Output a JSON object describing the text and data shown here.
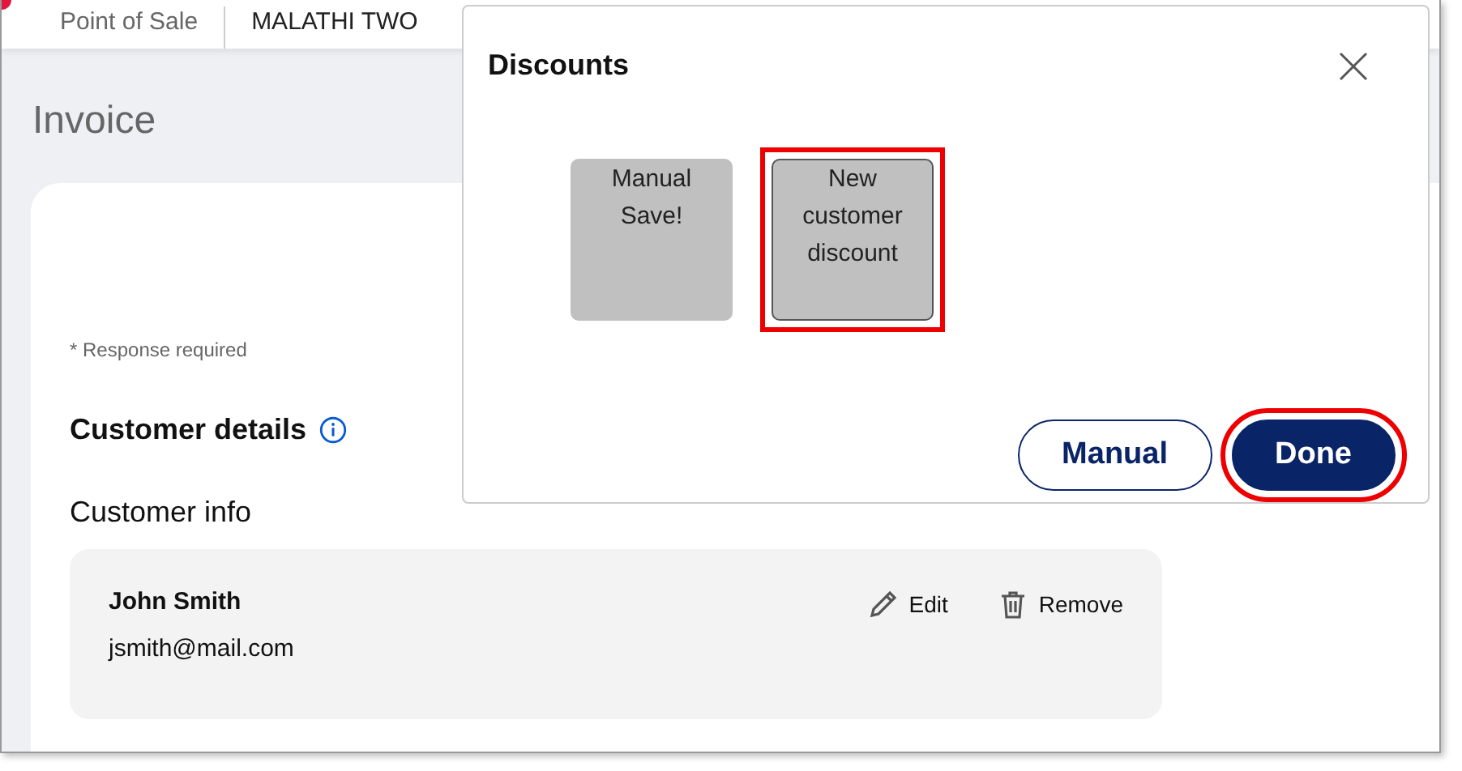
{
  "header": {
    "app_name": "Point of Sale",
    "store_name": "MALATHI TWO"
  },
  "page": {
    "title": "Invoice",
    "required_note": "* Response required",
    "section_title": "Customer details",
    "subsection_title": "Customer info"
  },
  "customer": {
    "name": "John Smith",
    "email": "jsmith@mail.com",
    "actions": [
      {
        "kind": "edit",
        "label": "Edit"
      },
      {
        "kind": "remove",
        "label": "Remove"
      }
    ]
  },
  "dialog": {
    "title": "Discounts",
    "discounts": [
      {
        "label": "Manual Save!",
        "selected": false,
        "highlighted": false
      },
      {
        "label": "New customer discount",
        "selected": true,
        "highlighted": true
      }
    ],
    "buttons": [
      {
        "kind": "secondary",
        "label": "Manual",
        "highlighted": false
      },
      {
        "kind": "primary",
        "label": "Done",
        "highlighted": true
      }
    ]
  }
}
